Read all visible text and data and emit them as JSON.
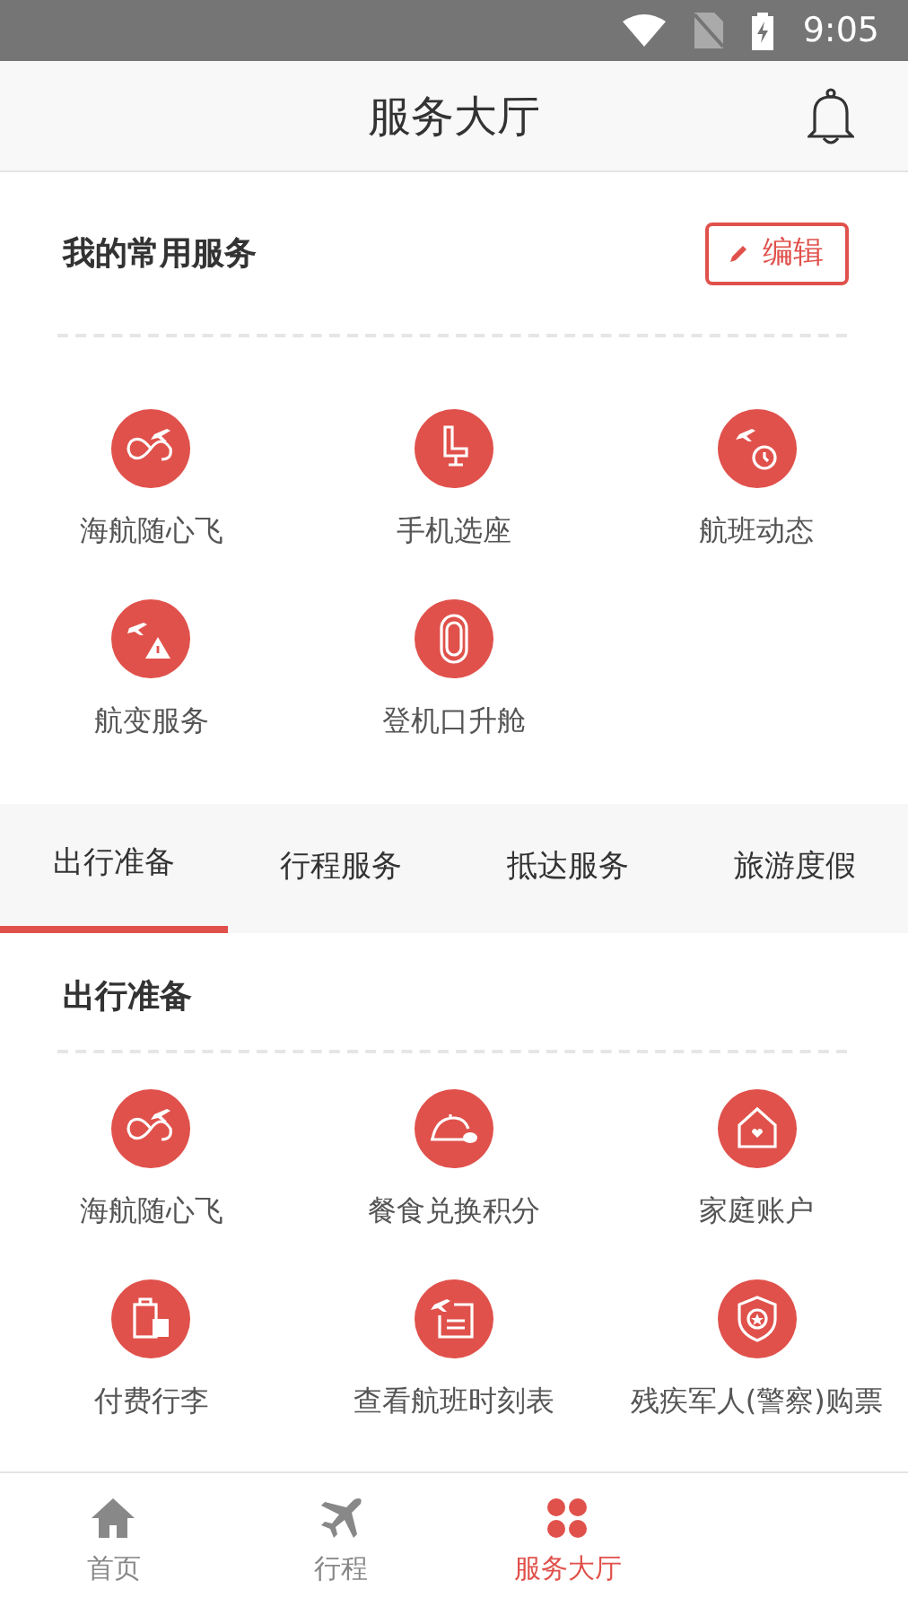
{
  "status_bar": {
    "time": "9:05"
  },
  "header": {
    "title": "服务大厅"
  },
  "favorites": {
    "title": "我的常用服务",
    "edit_button": "编辑",
    "items": [
      {
        "label": "海航随心飞"
      },
      {
        "label": "手机选座"
      },
      {
        "label": "航班动态"
      },
      {
        "label": "航变服务"
      },
      {
        "label": "登机口升舱"
      }
    ]
  },
  "tabs": [
    {
      "label": "出行准备",
      "selected": true
    },
    {
      "label": "行程服务",
      "selected": false
    },
    {
      "label": "抵达服务",
      "selected": false
    },
    {
      "label": "旅游度假",
      "selected": false
    }
  ],
  "section": {
    "title": "出行准备",
    "items": [
      {
        "label": "海航随心飞"
      },
      {
        "label": "餐食兑换积分"
      },
      {
        "label": "家庭账户"
      },
      {
        "label": "付费行李"
      },
      {
        "label": "查看航班时刻表"
      },
      {
        "label": "残疾军人(警察)购票"
      }
    ]
  },
  "bottom_nav": [
    {
      "label": "首页",
      "selected": false
    },
    {
      "label": "行程",
      "selected": false
    },
    {
      "label": "服务大厅",
      "selected": true
    }
  ]
}
